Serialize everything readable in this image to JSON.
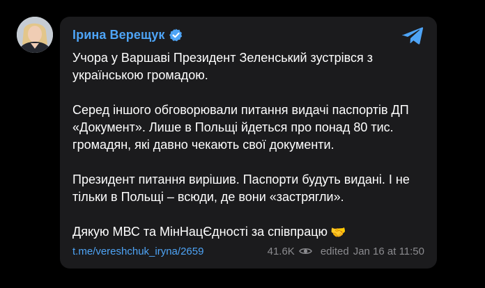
{
  "author": {
    "name": "Ірина Верещук"
  },
  "message": {
    "paragraphs": [
      "Учора у Варшаві Президент Зеленський зустрівся з українською громадою.",
      "Серед іншого обговорювали питання видачі паспортів ДП «Документ». Лише в Польщі йдеться про понад 80 тис. громадян, які давно чекають свої документи.",
      "Президент питання вирішив. Паспорти будуть видані. І не тільки в Польщі – всюди, де вони «застрягли».",
      "Дякую МВС та МінНацЄдності за співпрацю"
    ],
    "emoji": "🤝"
  },
  "footer": {
    "link": "t.me/vereshchuk_iryna/2659",
    "views": "41.6K",
    "edited": "edited",
    "date": "Jan 16 at 11:50"
  },
  "icons": {
    "verified": "verified-badge-icon",
    "telegram": "telegram-plane-icon",
    "views": "eye-icon"
  },
  "colors": {
    "background": "#000000",
    "card": "#1b1b1d",
    "accent": "#4ea4f6",
    "text": "#ffffff",
    "muted": "#8b8b8f"
  }
}
